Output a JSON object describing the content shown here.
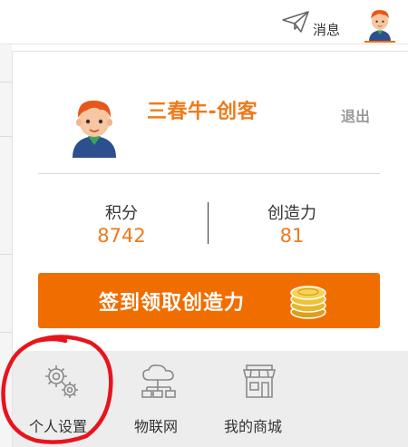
{
  "topbar": {
    "message_label": "消息"
  },
  "user": {
    "name": "三春牛-创客",
    "logout_label": "退出"
  },
  "stats": {
    "points_label": "积分",
    "points_value": "8742",
    "creativity_label": "创造力",
    "creativity_value": "81"
  },
  "checkin": {
    "label": "签到领取创造力"
  },
  "menu": {
    "items": [
      {
        "label": "个人设置",
        "icon": "gears-icon"
      },
      {
        "label": "物联网",
        "icon": "cloud-network-icon"
      },
      {
        "label": "我的商城",
        "icon": "storefront-icon"
      }
    ]
  },
  "colors": {
    "accent": "#f06e00",
    "accent_text": "#ef7a1a",
    "annotation": "#e8141c"
  }
}
